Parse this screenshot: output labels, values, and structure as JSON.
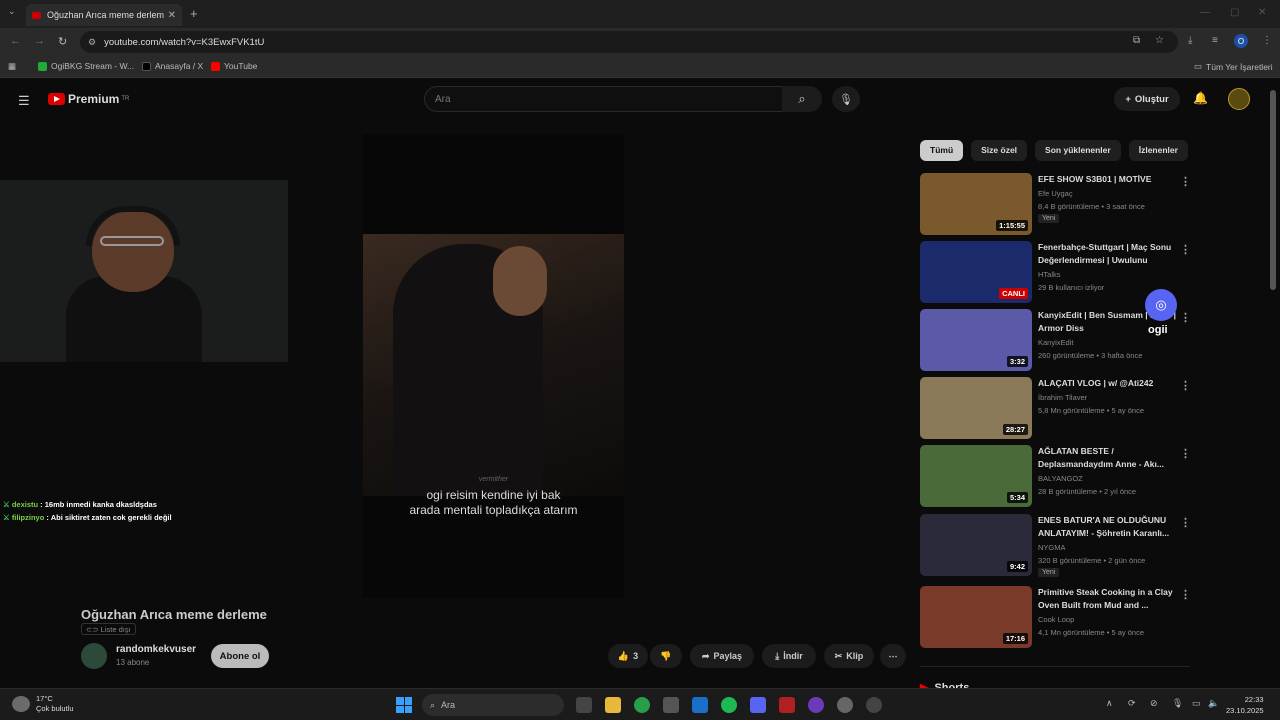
{
  "browser": {
    "tab_title": "Oğuzhan Arıca meme derleme",
    "tab_close": "✕",
    "new_tab": "+",
    "url": "youtube.com/watch?v=K3EwxFVK1tU",
    "profile_letter": "O",
    "bookmarks": [
      {
        "label": "OgiBKG Stream - W...",
        "color": "#1faa3a"
      },
      {
        "label": "Anasayfa / X",
        "color": "#000000"
      },
      {
        "label": "YouTube",
        "color": "#ff0000"
      }
    ],
    "all_bookmarks": "Tüm Yer İşaretleri"
  },
  "youtube": {
    "logo_text": "Premium",
    "logo_sup": "TR",
    "search_placeholder": "Ara",
    "create_label": "Oluştur",
    "video": {
      "subtitle_line1": "ogi reisim kendine iyi bak",
      "subtitle_line2": "arada mentali topladıkça atarım",
      "watermark": "vermither",
      "title": "Oğuzhan Arıca meme derleme",
      "playlist_label": "Liste dışı",
      "channel": "randomkekvuser",
      "subscribers": "13 abone",
      "subscribe_label": "Abone ol",
      "likes": "3",
      "share": "Paylaş",
      "download": "İndir",
      "clip": "Klip"
    },
    "chat": [
      {
        "user": "dexistu",
        "message": " : 16mb inmedi kanka dkasldşdas"
      },
      {
        "user": "filipzinyo",
        "message": " : Abi siktiret zaten cok gerekli değil"
      }
    ],
    "chips": [
      "Tümü",
      "Size özel",
      "Son yüklenenler",
      "İzlenenler"
    ],
    "recommendations": [
      {
        "title": "EFE SHOW S3B01 | MOTİVE",
        "channel": "Efe Uygaç",
        "meta": "8,4 B görüntüleme • 3 saat önce",
        "duration": "1:15:55",
        "badge": "Yeni",
        "thumb": "#7a5a2c"
      },
      {
        "title": "Fenerbahçe-Stuttgart | Maç Sonu Değerlendirmesi | Uwulunu",
        "channel": "HTalks",
        "meta": "29 B kullanıcı izliyor",
        "duration": "CANLI",
        "badge": "",
        "thumb": "#1a2a6a"
      },
      {
        "title": "KanyixEdit | Ben Susmam | KekV | Armor Diss",
        "channel": "KanyixEdit",
        "meta": "260 görüntüleme • 3 hafta önce",
        "duration": "3:32",
        "badge": "",
        "thumb": "#5a5aa8"
      },
      {
        "title": "ALAÇATI VLOG | w/ @Ati242",
        "channel": "İbrahim Tilaver",
        "meta": "5,8 Mn görüntüleme • 5 ay önce",
        "duration": "28:27",
        "badge": "",
        "thumb": "#8a7a5a"
      },
      {
        "title": "AĞLATAN BESTE / Deplasmandaydım Anne - Akı...",
        "channel": "BALYANGOZ",
        "meta": "28 B görüntüleme • 2 yıl önce",
        "duration": "5:34",
        "badge": "",
        "thumb": "#4a6a3a"
      },
      {
        "title": "ENES BATUR'A NE OLDUĞUNU ANLATAYIM! - Şöhretin Karanlı...",
        "channel": "NYGMA",
        "meta": "320 B görüntüleme • 2 gün önce",
        "duration": "9:42",
        "badge": "Yeni",
        "thumb": "#2a2a3a"
      },
      {
        "title": "Primitive Steak Cooking in a Clay Oven Built from Mud and ...",
        "channel": "Cook Loop",
        "meta": "4,1 Mn görüntüleme • 5 ay önce",
        "duration": "17:16",
        "badge": "",
        "thumb": "#7a3a2a"
      }
    ],
    "shorts_label": "Shorts",
    "discord_name": "ogii"
  },
  "taskbar": {
    "temperature": "17°C",
    "weather": "Çok bulutlu",
    "search": "Ara",
    "time": "22:33",
    "date": "23.10.2025"
  }
}
